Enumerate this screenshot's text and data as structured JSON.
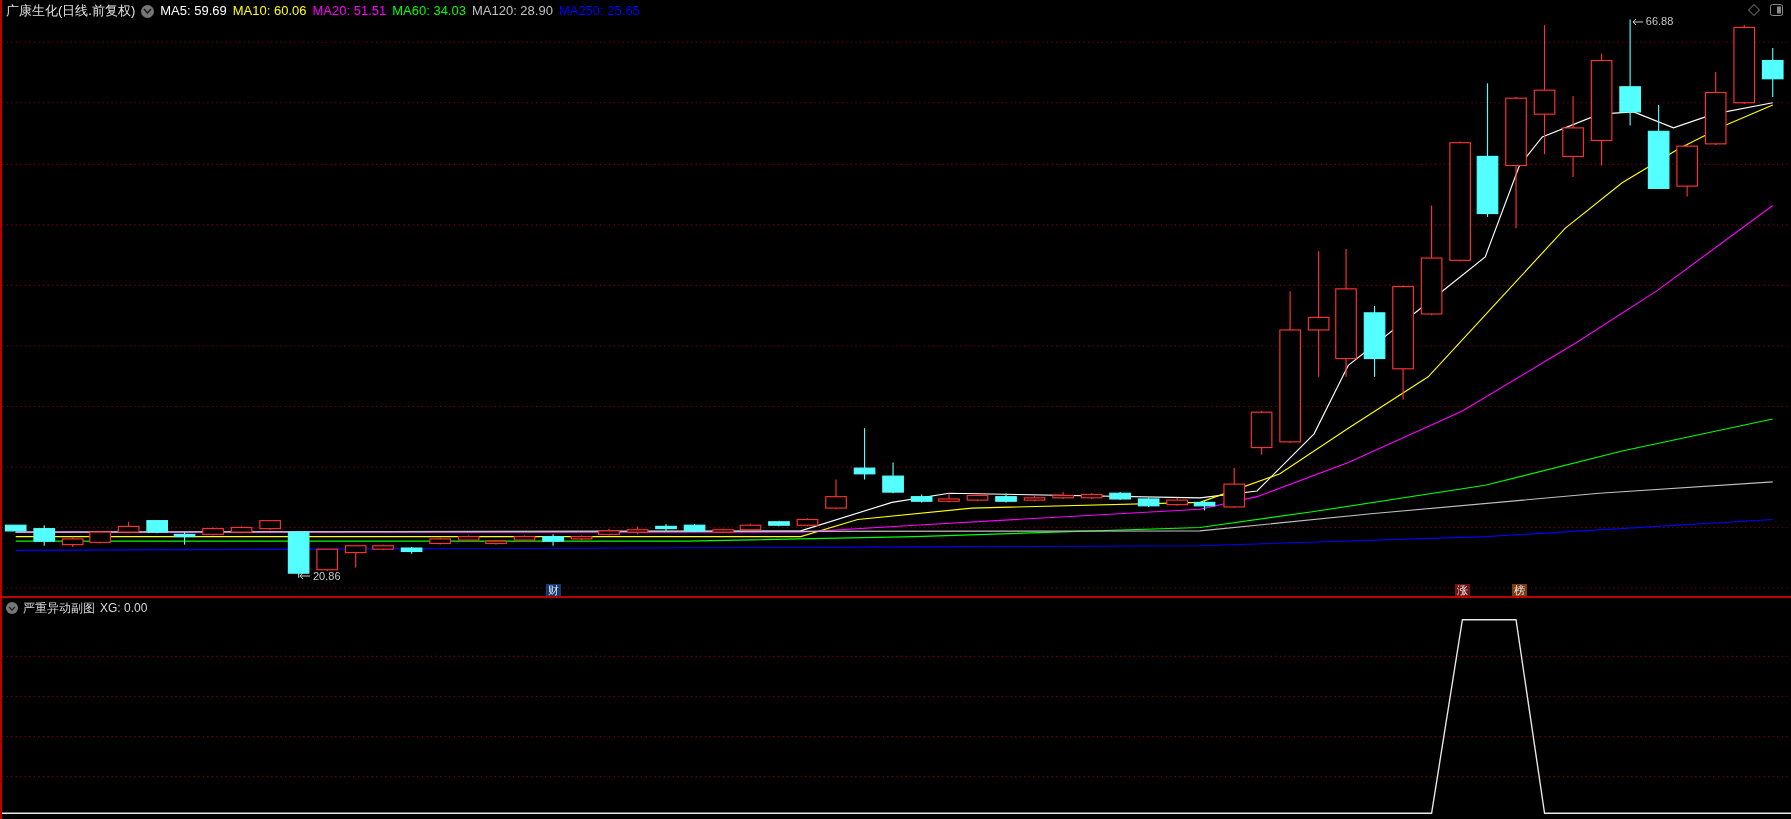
{
  "main_panel": {
    "title": "广康生化(日线.前复权)",
    "indicators": [
      {
        "label": "MA5: 59.69",
        "color": "#ffffff"
      },
      {
        "label": "MA10: 60.06",
        "color": "#ffff00"
      },
      {
        "label": "MA20: 51.51",
        "color": "#ff00ff"
      },
      {
        "label": "MA60: 34.03",
        "color": "#00ff00"
      },
      {
        "label": "MA120: 28.90",
        "color": "#c0c0c0"
      },
      {
        "label": "MA250: 25.65",
        "color": "#0000ff"
      }
    ],
    "price_marks": [
      {
        "kind": "low",
        "text": "20.86"
      },
      {
        "kind": "high",
        "text": "66.88"
      }
    ],
    "event_markers": [
      {
        "text": "财",
        "color": "#17386e"
      },
      {
        "text": "涨",
        "color": "#6e1414"
      },
      {
        "text": "榜",
        "color": "#7a3c10"
      }
    ]
  },
  "sub_panel": {
    "title": "严重异动副图",
    "reading": "XG: 0.00"
  }
}
